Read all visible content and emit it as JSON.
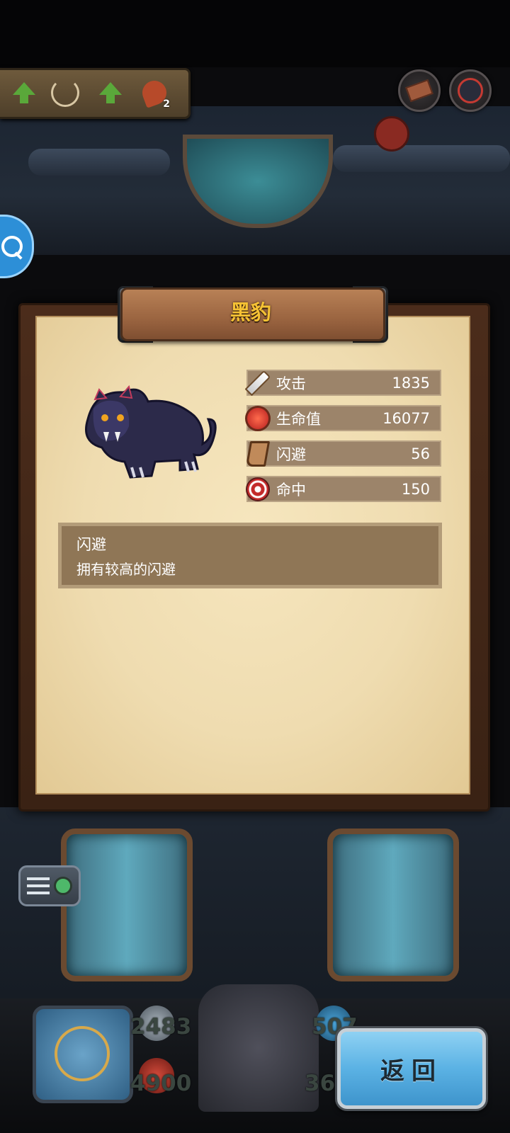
{
  "buff_bar": {
    "icons": [
      "up-arrow-icon",
      "candelabra-icon",
      "up-arrow-icon",
      "fire-beast-icon"
    ],
    "fire_count": "2"
  },
  "top_right_buttons": [
    "brick-icon",
    "beast-head-icon"
  ],
  "monster": {
    "name": "黑豹",
    "stats": [
      {
        "label": "攻击",
        "value": "1835",
        "icon": "sword-icon"
      },
      {
        "label": "生命值",
        "value": "16077",
        "icon": "potion-icon"
      },
      {
        "label": "闪避",
        "value": "56",
        "icon": "boot-icon"
      },
      {
        "label": "命中",
        "value": "150",
        "icon": "target-icon"
      }
    ],
    "skill": {
      "name": "闪避",
      "description": "拥有较高的闪避"
    }
  },
  "hud": {
    "attack": "2483",
    "health": "4900",
    "defense": "507",
    "gold": "36"
  },
  "back_button": {
    "label": "返回"
  },
  "colors": {
    "title_gold": "#f6c234",
    "stat_row": "#9c846a",
    "paper": "#efdcb0",
    "back_button": "#5bb2e4"
  }
}
